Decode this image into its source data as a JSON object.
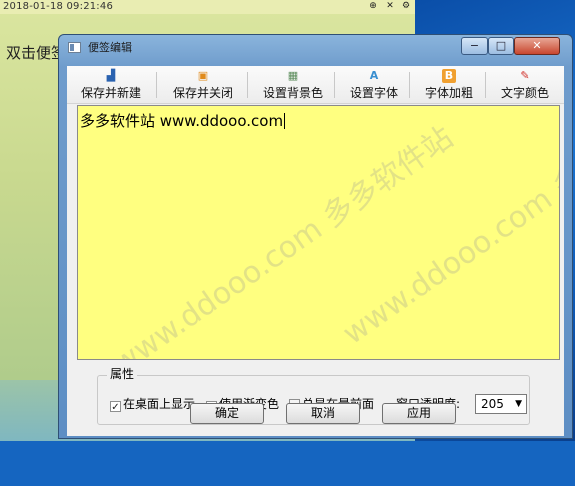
{
  "desktop_note": {
    "timestamp": "2018-01-18 09:21:46",
    "text": "双击便签"
  },
  "dialog": {
    "title": "便签编辑",
    "window_controls": {
      "minimize": "−",
      "maximize": "□",
      "close": "✕"
    }
  },
  "toolbar": {
    "items": [
      {
        "label": "保存并新建",
        "icon": "save-new-icon"
      },
      {
        "label": "保存并关闭",
        "icon": "save-close-icon"
      },
      {
        "label": "设置背景色",
        "icon": "background-color-icon"
      },
      {
        "label": "设置字体",
        "icon": "font-icon"
      },
      {
        "label": "字体加粗",
        "icon": "bold-icon"
      },
      {
        "label": "文字颜色",
        "icon": "text-color-icon"
      }
    ]
  },
  "editor": {
    "content": "多多软件站  www.ddooo.com",
    "background": "#ffff80"
  },
  "watermark": "www.ddooo.com 多多软件站",
  "properties": {
    "group_title": "属性",
    "show_on_desktop": {
      "label": "在桌面上显示",
      "checked": true
    },
    "use_gradient": {
      "label": "使用渐变色",
      "checked": true
    },
    "always_on_top": {
      "label": "总是在最前面",
      "checked": false
    },
    "opacity_label": "窗口透明度:",
    "opacity_value": "205"
  },
  "buttons": {
    "ok": "确定",
    "cancel": "取消",
    "apply": "应用"
  },
  "colors": {
    "accent": "#1565c0",
    "note": "#ffff80"
  }
}
